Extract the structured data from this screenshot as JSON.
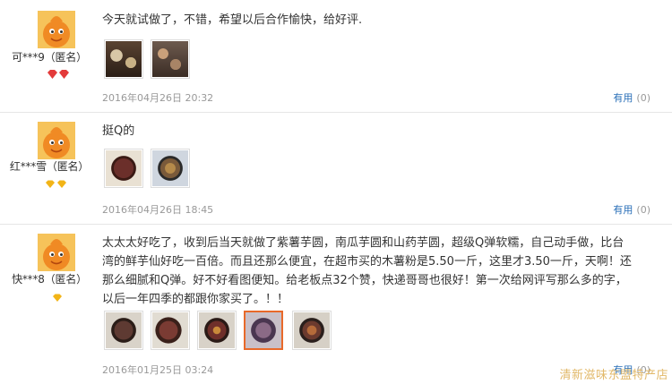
{
  "reviews": [
    {
      "user": "可***9（匿名）",
      "level_icon": "red-diamond-icon",
      "text": "今天就试做了，不错，希望以后合作愉快，给好评.",
      "images": [
        "review-photo-1",
        "review-photo-2"
      ],
      "date": "2016年04月26日 20:32",
      "helpful_label": "有用",
      "helpful_count": "(0)"
    },
    {
      "user": "红***雪（匿名）",
      "level_icon": "gold-diamond-icon",
      "text": "挺Q的",
      "images": [
        "review-photo-1",
        "review-photo-2"
      ],
      "date": "2016年04月26日 18:45",
      "helpful_label": "有用",
      "helpful_count": "(0)"
    },
    {
      "user": "快***8（匿名）",
      "level_icon": "gold-diamond-icon",
      "text_lines": [
        "太太太好吃了，收到后当天就做了紫薯芋圆，南瓜芋圆和山药芋圆，超级Q弹软糯，自己动手做，比台",
        "湾的鲜芋仙好吃一百倍。而且还那么便宜，在超市买的木薯粉是5.50一斤，这里才3.50一斤，天啊！还",
        "那么细腻和Q弹。好不好看图便知。给老板点32个赞，快递哥哥也很好！第一次给网评写那么多的字，",
        "以后一年四季的都跟你家买了。！！"
      ],
      "images": [
        "review-photo-1",
        "review-photo-2",
        "review-photo-3",
        "review-photo-4",
        "review-photo-5"
      ],
      "date": "2016年01月25日 03:24",
      "helpful_label": "有用",
      "helpful_count": "(0)"
    }
  ],
  "watermark": "清新滋味东盟特产店",
  "colors": {
    "link": "#2a6fb8",
    "muted": "#999999",
    "selected_border": "#e8692a",
    "watermark": "#e2b96a"
  }
}
